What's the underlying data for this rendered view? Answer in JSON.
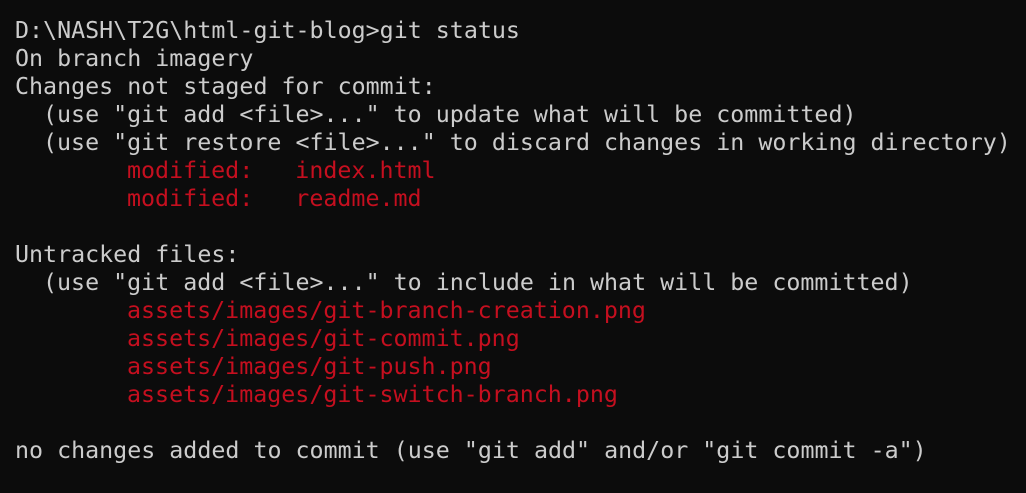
{
  "terminal": {
    "prompt": "D:\\NASH\\T2G\\html-git-blog>git status",
    "branch_line": "On branch imagery",
    "changes_header": "Changes not staged for commit:",
    "changes_hint_1": "(use \"git add <file>...\" to update what will be committed)",
    "changes_hint_2": "(use \"git restore <file>...\" to discard changes in working directory)",
    "modified": [
      "modified:   index.html",
      "modified:   readme.md"
    ],
    "untracked_header": "Untracked files:",
    "untracked_hint": "(use \"git add <file>...\" to include in what will be committed)",
    "untracked": [
      "assets/images/git-branch-creation.png",
      "assets/images/git-commit.png",
      "assets/images/git-push.png",
      "assets/images/git-switch-branch.png"
    ],
    "summary": "no changes added to commit (use \"git add\" and/or \"git commit -a\")"
  },
  "colors": {
    "background": "#0c0c0c",
    "foreground": "#cccccc",
    "red": "#c50f1f"
  }
}
